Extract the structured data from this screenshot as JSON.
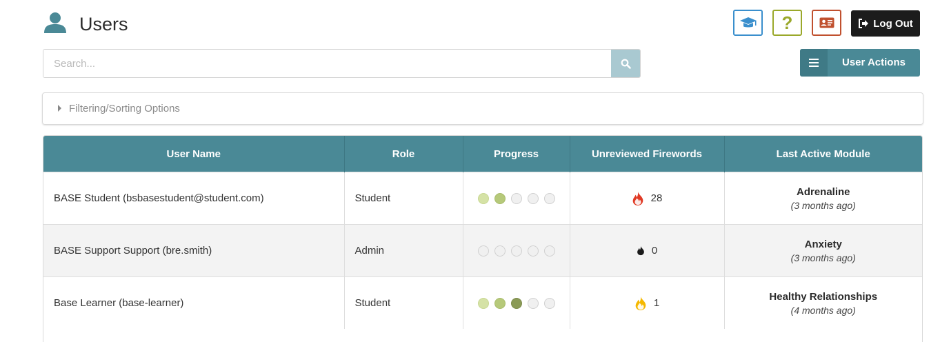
{
  "header": {
    "title": "Users",
    "logout_label": "Log Out",
    "icons": [
      "user-icon",
      "graduation-cap-icon",
      "question-mark-icon",
      "id-card-icon",
      "sign-out-icon"
    ],
    "colors": {
      "learn_border": "#3a8fcd",
      "help_border": "#9aa82a",
      "card_border": "#c0502e",
      "logout_bg": "#1c1c1c"
    },
    "help_glyph": "?"
  },
  "search": {
    "placeholder": "Search...",
    "value": ""
  },
  "user_actions": {
    "label": "User Actions",
    "color": "#4a8996"
  },
  "filter": {
    "label": "Filtering/Sorting Options"
  },
  "table": {
    "columns": [
      "User Name",
      "Role",
      "Progress",
      "Unreviewed Firewords",
      "Last Active Module"
    ],
    "header_color": "#4a8996",
    "rows": [
      {
        "name": "BASE Student (bsbasestudent@student.com)",
        "role": "Student",
        "progress": [
          1,
          2,
          0,
          0,
          0
        ],
        "firewords_icon": "fire-icon-red",
        "firewords": "28",
        "module": "Adrenaline",
        "module_time": "(3 months ago)"
      },
      {
        "name": "BASE Support Support (bre.smith)",
        "role": "Admin",
        "progress": [
          0,
          0,
          0,
          0,
          0
        ],
        "firewords_icon": "fire-icon-black",
        "firewords": "0",
        "module": "Anxiety",
        "module_time": "(3 months ago)"
      },
      {
        "name": "Base Learner (base-learner)",
        "role": "Student",
        "progress": [
          1,
          2,
          3,
          0,
          0
        ],
        "firewords_icon": "fire-icon-yellow",
        "firewords": "1",
        "module": "Healthy Relationships",
        "module_time": "(4 months ago)"
      }
    ]
  }
}
